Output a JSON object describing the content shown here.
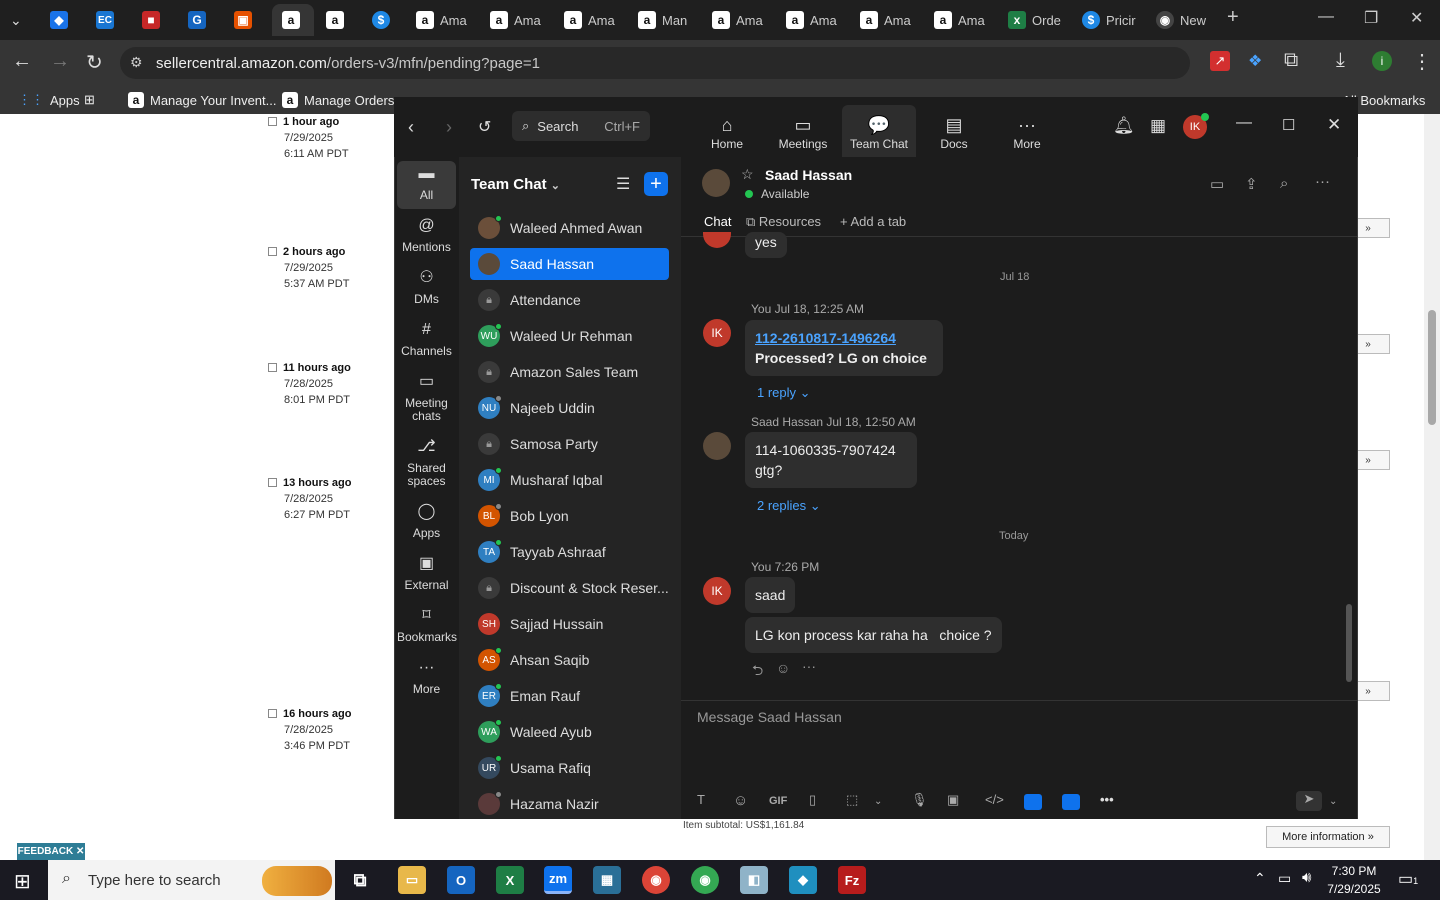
{
  "browser": {
    "tabs": [
      {
        "icon": "chevron-down-icon",
        "title": ""
      },
      {
        "icon": "edge-icon",
        "title": ""
      },
      {
        "icon": "ec-icon",
        "title": ""
      },
      {
        "icon": "red-app-icon",
        "title": ""
      },
      {
        "icon": "g-icon",
        "title": ""
      },
      {
        "icon": "box-icon",
        "title": ""
      },
      {
        "icon": "amazon-icon",
        "title": ""
      },
      {
        "icon": "amazon-icon",
        "title": ""
      },
      {
        "icon": "dollar-icon",
        "title": ""
      },
      {
        "icon": "amazon-icon",
        "title": "Ama"
      },
      {
        "icon": "amazon-icon",
        "title": "Ama"
      },
      {
        "icon": "amazon-icon",
        "title": "Ama"
      },
      {
        "icon": "amazon-icon",
        "title": "Man"
      },
      {
        "icon": "amazon-icon",
        "title": "Ama"
      },
      {
        "icon": "amazon-icon",
        "title": "Ama"
      },
      {
        "icon": "amazon-icon",
        "title": "Ama"
      },
      {
        "icon": "amazon-icon",
        "title": "Ama"
      },
      {
        "icon": "excel-icon",
        "title": "Orde"
      },
      {
        "icon": "dollar-icon",
        "title": "Pricir"
      },
      {
        "icon": "chrome-icon",
        "title": "New"
      }
    ],
    "url_host": "sellercentral.amazon.com",
    "url_path": "/orders-v3/mfn/pending?page=1",
    "bookmarks": [
      "Apps",
      "Manage Your Invent...",
      "Manage Orders"
    ],
    "all_bookmarks": "All Bookmarks"
  },
  "seller": {
    "rows": [
      {
        "ago": "1 hour ago",
        "date": "7/29/2025",
        "time": "6:11 AM PDT"
      },
      {
        "ago": "2 hours ago",
        "date": "7/29/2025",
        "time": "5:37 AM PDT"
      },
      {
        "ago": "11 hours ago",
        "date": "7/28/2025",
        "time": "8:01 PM PDT"
      },
      {
        "ago": "13 hours ago",
        "date": "7/28/2025",
        "time": "6:27 PM PDT"
      },
      {
        "ago": "16 hours ago",
        "date": "7/28/2025",
        "time": "3:46 PM PDT"
      }
    ],
    "subtotal": "Item subtotal: US$1,161.84",
    "more_info": "More information",
    "feedback": "FEEDBACK"
  },
  "zoom": {
    "search_label": "Search",
    "search_shortcut": "Ctrl+F",
    "nav": [
      {
        "label": "Home",
        "icon": "home-icon"
      },
      {
        "label": "Meetings",
        "icon": "video-icon"
      },
      {
        "label": "Team Chat",
        "icon": "chat-icon"
      },
      {
        "label": "Docs",
        "icon": "docs-icon"
      },
      {
        "label": "More",
        "icon": "more-icon"
      }
    ],
    "avatar_initials": "IK",
    "rail": [
      {
        "label": "All",
        "icon": "chat-bubble-icon"
      },
      {
        "label": "Mentions",
        "icon": "at-icon"
      },
      {
        "label": "DMs",
        "icon": "people-icon"
      },
      {
        "label": "Channels",
        "icon": "hash-icon"
      },
      {
        "label": "Meeting chats",
        "icon": "calendar-icon"
      },
      {
        "label": "Shared spaces",
        "icon": "share-icon"
      },
      {
        "label": "Apps",
        "icon": "apps-icon"
      },
      {
        "label": "External",
        "icon": "external-icon"
      },
      {
        "label": "Bookmarks",
        "icon": "bookmark-icon"
      },
      {
        "label": "More",
        "icon": "more-icon"
      }
    ],
    "list_title": "Team Chat",
    "contacts": [
      {
        "name": "Waleed Ahmed Awan",
        "initials": "",
        "color": "#6b4f3a",
        "lock": false,
        "online": true
      },
      {
        "name": "Saad Hassan",
        "initials": "",
        "color": "#5a4a3a",
        "lock": false,
        "online": false,
        "selected": true
      },
      {
        "name": "Attendance",
        "initials": "🔒",
        "color": "#3a3a3a",
        "lock": true,
        "online": false
      },
      {
        "name": "Waleed Ur Rehman",
        "initials": "WU",
        "color": "#2e9e5b",
        "lock": false,
        "online": true
      },
      {
        "name": "Amazon Sales Team",
        "initials": "🔒",
        "color": "#3a3a3a",
        "lock": true,
        "online": false
      },
      {
        "name": "Najeeb Uddin",
        "initials": "NU",
        "color": "#2f7fc1",
        "lock": false,
        "online": false
      },
      {
        "name": "Samosa Party",
        "initials": "🔒",
        "color": "#3a3a3a",
        "lock": true,
        "online": false
      },
      {
        "name": "Musharaf Iqbal",
        "initials": "MI",
        "color": "#2f7fc1",
        "lock": false,
        "online": true
      },
      {
        "name": "Bob Lyon",
        "initials": "BL",
        "color": "#d35400",
        "lock": false,
        "online": false
      },
      {
        "name": "Tayyab Ashraaf",
        "initials": "TA",
        "color": "#2f7fc1",
        "lock": false,
        "online": true
      },
      {
        "name": "Discount & Stock Reser...",
        "initials": "🔒",
        "color": "#3a3a3a",
        "lock": true,
        "online": false
      },
      {
        "name": "Sajjad Hussain",
        "initials": "SH",
        "color": "#c0392b",
        "lock": false,
        "online": false
      },
      {
        "name": "Ahsan Saqib",
        "initials": "AS",
        "color": "#d35400",
        "lock": false,
        "online": true
      },
      {
        "name": "Eman Rauf",
        "initials": "ER",
        "color": "#2f7fc1",
        "lock": false,
        "online": true
      },
      {
        "name": "Waleed Ayub",
        "initials": "WA",
        "color": "#2e9e5b",
        "lock": false,
        "online": true
      },
      {
        "name": "Usama Rafiq",
        "initials": "UR",
        "color": "#34495e",
        "lock": false,
        "online": true
      },
      {
        "name": "Hazama Nazir",
        "initials": "",
        "color": "#5a3a3a",
        "lock": false,
        "online": false
      }
    ],
    "chat": {
      "name": "Saad Hassan",
      "status": "Available",
      "tabs": [
        "Chat",
        "Resources",
        "Add a tab"
      ],
      "prev_msg": "yes",
      "day1": "Jul 18",
      "m1_meta": "You Jul 18, 12:25 AM",
      "m1_link": "112-2610817-1496264",
      "m1_text": "Processed?  LG on choice",
      "m1_replies": "1 reply",
      "m2_meta": "Saad Hassan Jul 18, 12:50 AM",
      "m2_line1": "114-1060335-7907424",
      "m2_line2": "gtg?",
      "m2_replies": "2 replies",
      "day2": "Today",
      "m3_meta": "You 7:26 PM",
      "m3_text": "saad",
      "m4_text": "LG kon process kar raha ha   choice ?",
      "placeholder": "Message Saad Hassan"
    }
  },
  "taskbar": {
    "search_placeholder": "Type here to search",
    "time": "7:30 PM",
    "date": "7/29/2025",
    "notifications": "1"
  }
}
